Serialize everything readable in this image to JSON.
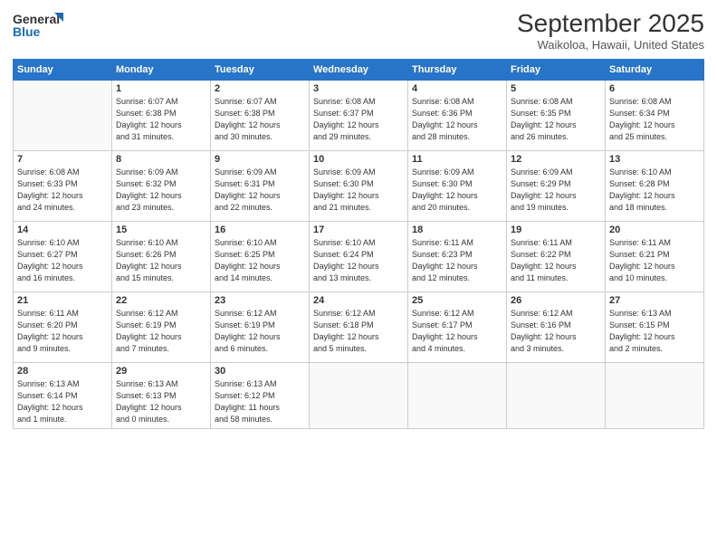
{
  "header": {
    "logo_line1": "General",
    "logo_line2": "Blue",
    "month": "September 2025",
    "location": "Waikoloa, Hawaii, United States"
  },
  "weekdays": [
    "Sunday",
    "Monday",
    "Tuesday",
    "Wednesday",
    "Thursday",
    "Friday",
    "Saturday"
  ],
  "weeks": [
    [
      {
        "day": "",
        "info": ""
      },
      {
        "day": "1",
        "info": "Sunrise: 6:07 AM\nSunset: 6:38 PM\nDaylight: 12 hours\nand 31 minutes."
      },
      {
        "day": "2",
        "info": "Sunrise: 6:07 AM\nSunset: 6:38 PM\nDaylight: 12 hours\nand 30 minutes."
      },
      {
        "day": "3",
        "info": "Sunrise: 6:08 AM\nSunset: 6:37 PM\nDaylight: 12 hours\nand 29 minutes."
      },
      {
        "day": "4",
        "info": "Sunrise: 6:08 AM\nSunset: 6:36 PM\nDaylight: 12 hours\nand 28 minutes."
      },
      {
        "day": "5",
        "info": "Sunrise: 6:08 AM\nSunset: 6:35 PM\nDaylight: 12 hours\nand 26 minutes."
      },
      {
        "day": "6",
        "info": "Sunrise: 6:08 AM\nSunset: 6:34 PM\nDaylight: 12 hours\nand 25 minutes."
      }
    ],
    [
      {
        "day": "7",
        "info": "Sunrise: 6:08 AM\nSunset: 6:33 PM\nDaylight: 12 hours\nand 24 minutes."
      },
      {
        "day": "8",
        "info": "Sunrise: 6:09 AM\nSunset: 6:32 PM\nDaylight: 12 hours\nand 23 minutes."
      },
      {
        "day": "9",
        "info": "Sunrise: 6:09 AM\nSunset: 6:31 PM\nDaylight: 12 hours\nand 22 minutes."
      },
      {
        "day": "10",
        "info": "Sunrise: 6:09 AM\nSunset: 6:30 PM\nDaylight: 12 hours\nand 21 minutes."
      },
      {
        "day": "11",
        "info": "Sunrise: 6:09 AM\nSunset: 6:30 PM\nDaylight: 12 hours\nand 20 minutes."
      },
      {
        "day": "12",
        "info": "Sunrise: 6:09 AM\nSunset: 6:29 PM\nDaylight: 12 hours\nand 19 minutes."
      },
      {
        "day": "13",
        "info": "Sunrise: 6:10 AM\nSunset: 6:28 PM\nDaylight: 12 hours\nand 18 minutes."
      }
    ],
    [
      {
        "day": "14",
        "info": "Sunrise: 6:10 AM\nSunset: 6:27 PM\nDaylight: 12 hours\nand 16 minutes."
      },
      {
        "day": "15",
        "info": "Sunrise: 6:10 AM\nSunset: 6:26 PM\nDaylight: 12 hours\nand 15 minutes."
      },
      {
        "day": "16",
        "info": "Sunrise: 6:10 AM\nSunset: 6:25 PM\nDaylight: 12 hours\nand 14 minutes."
      },
      {
        "day": "17",
        "info": "Sunrise: 6:10 AM\nSunset: 6:24 PM\nDaylight: 12 hours\nand 13 minutes."
      },
      {
        "day": "18",
        "info": "Sunrise: 6:11 AM\nSunset: 6:23 PM\nDaylight: 12 hours\nand 12 minutes."
      },
      {
        "day": "19",
        "info": "Sunrise: 6:11 AM\nSunset: 6:22 PM\nDaylight: 12 hours\nand 11 minutes."
      },
      {
        "day": "20",
        "info": "Sunrise: 6:11 AM\nSunset: 6:21 PM\nDaylight: 12 hours\nand 10 minutes."
      }
    ],
    [
      {
        "day": "21",
        "info": "Sunrise: 6:11 AM\nSunset: 6:20 PM\nDaylight: 12 hours\nand 9 minutes."
      },
      {
        "day": "22",
        "info": "Sunrise: 6:12 AM\nSunset: 6:19 PM\nDaylight: 12 hours\nand 7 minutes."
      },
      {
        "day": "23",
        "info": "Sunrise: 6:12 AM\nSunset: 6:19 PM\nDaylight: 12 hours\nand 6 minutes."
      },
      {
        "day": "24",
        "info": "Sunrise: 6:12 AM\nSunset: 6:18 PM\nDaylight: 12 hours\nand 5 minutes."
      },
      {
        "day": "25",
        "info": "Sunrise: 6:12 AM\nSunset: 6:17 PM\nDaylight: 12 hours\nand 4 minutes."
      },
      {
        "day": "26",
        "info": "Sunrise: 6:12 AM\nSunset: 6:16 PM\nDaylight: 12 hours\nand 3 minutes."
      },
      {
        "day": "27",
        "info": "Sunrise: 6:13 AM\nSunset: 6:15 PM\nDaylight: 12 hours\nand 2 minutes."
      }
    ],
    [
      {
        "day": "28",
        "info": "Sunrise: 6:13 AM\nSunset: 6:14 PM\nDaylight: 12 hours\nand 1 minute."
      },
      {
        "day": "29",
        "info": "Sunrise: 6:13 AM\nSunset: 6:13 PM\nDaylight: 12 hours\nand 0 minutes."
      },
      {
        "day": "30",
        "info": "Sunrise: 6:13 AM\nSunset: 6:12 PM\nDaylight: 11 hours\nand 58 minutes."
      },
      {
        "day": "",
        "info": ""
      },
      {
        "day": "",
        "info": ""
      },
      {
        "day": "",
        "info": ""
      },
      {
        "day": "",
        "info": ""
      }
    ]
  ]
}
